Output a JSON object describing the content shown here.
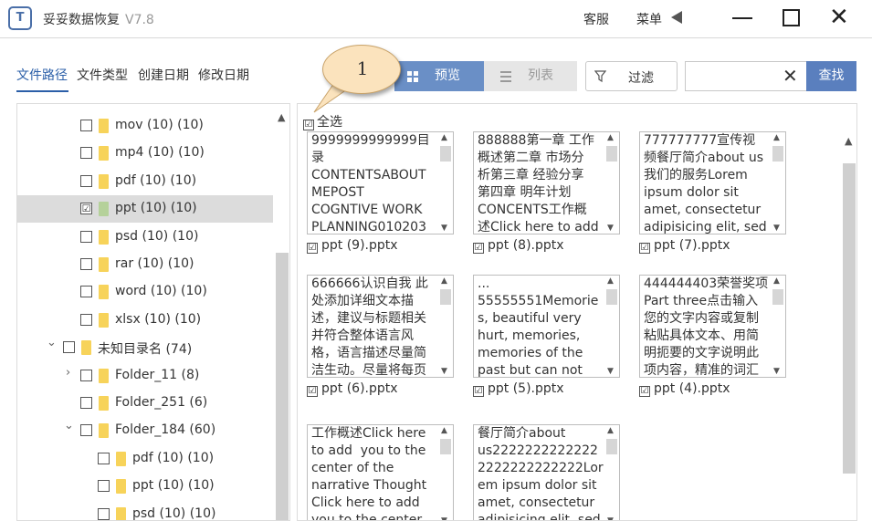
{
  "app": {
    "title": "妥妥数据恢复",
    "version": "V7.8",
    "logo": "T"
  },
  "titlebar": {
    "support": "客服",
    "menu": "菜单"
  },
  "left_tabs": [
    "文件路径",
    "文件类型",
    "创建日期",
    "修改日期"
  ],
  "toolbar": {
    "preview": "预览",
    "list": "列表",
    "filter": "过滤",
    "search_value": "",
    "search_button": "查找"
  },
  "callout": {
    "number": "1"
  },
  "main": {
    "select_all": "全选",
    "select_all_checked": "☑"
  },
  "tree": [
    {
      "label": "mov (10)  (10)",
      "checked": ""
    },
    {
      "label": "mp4 (10)  (10)",
      "checked": ""
    },
    {
      "label": "pdf (10)  (10)",
      "checked": ""
    },
    {
      "label": "ppt (10)  (10)",
      "checked": "☑"
    },
    {
      "label": "psd (10)  (10)",
      "checked": ""
    },
    {
      "label": "rar (10)  (10)",
      "checked": ""
    },
    {
      "label": "word (10)  (10)",
      "checked": ""
    },
    {
      "label": "xlsx (10)  (10)",
      "checked": ""
    },
    {
      "label": "未知目录名  (74)",
      "checked": "",
      "expander": "⌄"
    },
    {
      "label": "Folder_11  (8)",
      "checked": "",
      "expander": "›"
    },
    {
      "label": "Folder_251  (6)",
      "checked": ""
    },
    {
      "label": "Folder_184  (60)",
      "checked": "",
      "expander": "⌄"
    },
    {
      "label": "pdf (10)  (10)",
      "checked": ""
    },
    {
      "label": "ppt (10)  (10)",
      "checked": ""
    },
    {
      "label": "psd (10)  (10)",
      "checked": ""
    }
  ],
  "files": [
    {
      "text": "9999999999999目\n录\nCONTENTSABOUT\nMEPOST\nCOGNTIVE WORK\nPLANNING010203",
      "name": "ppt (9).pptx",
      "checked": "☑"
    },
    {
      "text": "888888第一章 工作\n概述第二章 市场分\n析第三章 经验分享\n第四章 明年计划\nCONCENTS工作概\n述Click here to add",
      "name": "ppt (8).pptx",
      "checked": "☑"
    },
    {
      "text": "777777777宣传视\n频餐厅简介about us\n我们的服务Lorem\nipsum dolor sit\namet, consectetur\nadipisicing elit, sed",
      "name": "ppt (7).pptx",
      "checked": "☑"
    },
    {
      "text": "666666认识自我 此\n处添加详细文本描\n述，建议与标题相关\n并符合整体语言风\n格，语言描述尽量简\n洁生动。尽量将每页",
      "name": "ppt (6).pptx",
      "checked": "☑"
    },
    {
      "text": "...\n55555551Memorie\ns, beautiful very\nhurt, memories,\nmemories of the\npast but can not",
      "name": "ppt (5).pptx",
      "checked": "☑"
    },
    {
      "text": "444444403荣誉奖项\nPart three点击输入\n您的文字内容或复制\n粘贴具体文本、用简\n明扼要的文字说明此\n项内容，精准的词汇",
      "name": "ppt (4).pptx",
      "checked": "☑"
    },
    {
      "text": "工作概述Click here\nto add  you to the\ncenter of the\nnarrative Thought\nClick here to add\nyou to the center",
      "name": "",
      "checked": ""
    },
    {
      "text": "餐厅简介about\nus2222222222222\n2222222222222Lor\nem ipsum dolor sit\namet, consectetur\nadipisicing elit, sed",
      "name": "",
      "checked": ""
    }
  ]
}
